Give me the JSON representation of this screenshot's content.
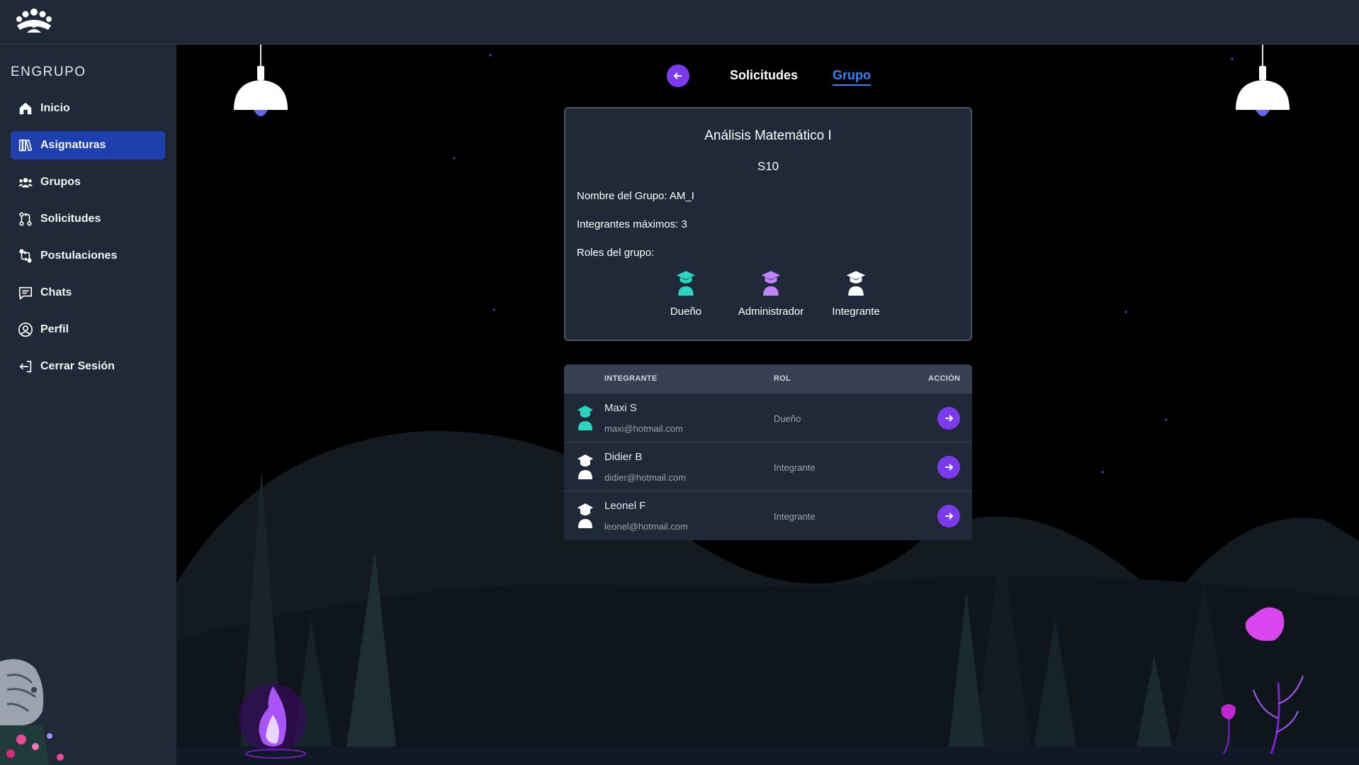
{
  "app": {
    "brand": "ENGRUPO"
  },
  "sidebar": {
    "items": [
      {
        "label": "Inicio",
        "icon": "home-icon",
        "active": false
      },
      {
        "label": "Asignaturas",
        "icon": "books-icon",
        "active": true
      },
      {
        "label": "Grupos",
        "icon": "users-icon",
        "active": false
      },
      {
        "label": "Solicitudes",
        "icon": "git-pull-request-icon",
        "active": false
      },
      {
        "label": "Postulaciones",
        "icon": "git-compare-icon",
        "active": false
      },
      {
        "label": "Chats",
        "icon": "message-icon",
        "active": false
      },
      {
        "label": "Perfil",
        "icon": "user-circle-icon",
        "active": false
      },
      {
        "label": "Cerrar Sesión",
        "icon": "logout-icon",
        "active": false
      }
    ]
  },
  "tabs": {
    "solicitudes": "Solicitudes",
    "grupo": "Grupo"
  },
  "group": {
    "subject": "Análisis Matemático I",
    "code": "S10",
    "name_line": "Nombre del Grupo: AM_I",
    "max_line": "Integrantes máximos: 3",
    "roles_label": "Roles del grupo:",
    "roles": [
      {
        "label": "Dueño",
        "color": "#2dd4bf"
      },
      {
        "label": "Administrador",
        "color": "#c084fc"
      },
      {
        "label": "Integrante",
        "color": "#ffffff"
      }
    ]
  },
  "table": {
    "headers": {
      "member": "INTEGRANTE",
      "role": "ROL",
      "action": "ACCIÓN"
    },
    "rows": [
      {
        "name": "Maxi S",
        "email": "maxi@hotmail.com",
        "role": "Dueño",
        "color": "#2dd4bf"
      },
      {
        "name": "Didier B",
        "email": "didier@hotmail.com",
        "role": "Integrante",
        "color": "#ffffff"
      },
      {
        "name": "Leonel F",
        "email": "leonel@hotmail.com",
        "role": "Integrante",
        "color": "#ffffff"
      }
    ]
  },
  "colors": {
    "accent": "#7c3aed",
    "active_nav": "#1e40af",
    "link": "#3b82f6"
  }
}
